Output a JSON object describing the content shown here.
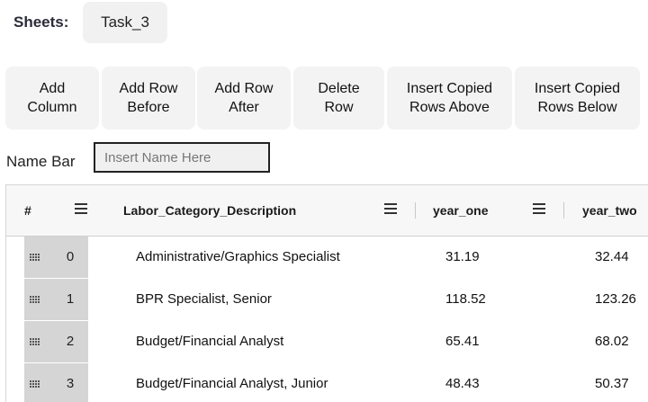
{
  "sheets": {
    "label": "Sheets:",
    "tabs": [
      "Task_3"
    ]
  },
  "toolbar": {
    "add_column": "Add\nColumn",
    "add_row_before": "Add Row\nBefore",
    "add_row_after": "Add Row\nAfter",
    "delete_row": "Delete\nRow",
    "insert_copied_above": "Insert Copied\nRows Above",
    "insert_copied_below": "Insert Copied\nRows Below"
  },
  "name_bar": {
    "label": "Name Bar",
    "placeholder": "Insert Name Here",
    "value": ""
  },
  "grid": {
    "columns": [
      "#",
      "Labor_Category_Description",
      "year_one",
      "year_two"
    ],
    "rows": [
      {
        "index": "0",
        "description": "Administrative/Graphics Specialist",
        "year_one": "31.19",
        "year_two": "32.44"
      },
      {
        "index": "1",
        "description": "BPR Specialist, Senior",
        "year_one": "118.52",
        "year_two": "123.26"
      },
      {
        "index": "2",
        "description": "Budget/Financial Analyst",
        "year_one": "65.41",
        "year_two": "68.02"
      },
      {
        "index": "3",
        "description": "Budget/Financial Analyst, Junior",
        "year_one": "48.43",
        "year_two": "50.37"
      }
    ]
  }
}
